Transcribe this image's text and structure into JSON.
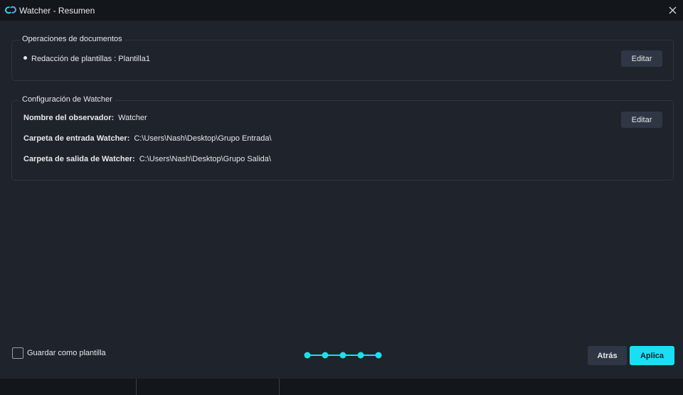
{
  "window": {
    "title": "Watcher - Resumen",
    "icon": "watcher-logo-icon",
    "close_icon": "close-icon"
  },
  "document_operations": {
    "legend": "Operaciones de documentos",
    "item": "Redacción de plantillas : Plantilla1",
    "edit_label": "Editar"
  },
  "watcher_config": {
    "legend": "Configuración de Watcher",
    "edit_label": "Editar",
    "observer_name_label": "Nombre del observador:",
    "observer_name_value": "Watcher",
    "input_folder_label": "Carpeta de entrada Watcher:",
    "input_folder_value": "C:\\Users\\Nash\\Desktop\\Grupo Entrada\\",
    "output_folder_label": "Carpeta de salida de Watcher:",
    "output_folder_value": "C:\\Users\\Nash\\Desktop\\Grupo Salida\\"
  },
  "footer": {
    "save_as_template_label": "Guardar como plantilla",
    "save_as_template_checked": false,
    "steps_total": 5,
    "steps_completed": 5,
    "back_label": "Atrás",
    "apply_label": "Aplica"
  },
  "colors": {
    "background": "#1f232b",
    "titlebar": "#13161b",
    "accent": "#19dff5",
    "button": "#2f3745",
    "border": "#2f3540"
  }
}
